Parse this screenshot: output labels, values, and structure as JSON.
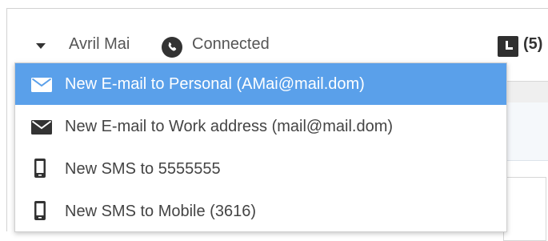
{
  "toolbar": {
    "contact_name": "Avril Mai",
    "status": "Connected",
    "history_count": "(5)"
  },
  "menu": {
    "items": [
      {
        "label": "New E-mail to Personal (AMai@mail.dom)",
        "icon": "mail-icon",
        "selected": true
      },
      {
        "label": "New E-mail to Work address (mail@mail.dom)",
        "icon": "mail-icon",
        "selected": false
      },
      {
        "label": "New SMS to 5555555",
        "icon": "mobile-icon",
        "selected": false
      },
      {
        "label": "New SMS to Mobile (3616)",
        "icon": "mobile-icon",
        "selected": false
      }
    ]
  },
  "colors": {
    "highlight": "#5aa0ea",
    "icon_dark": "#333333",
    "text": "#444444"
  }
}
